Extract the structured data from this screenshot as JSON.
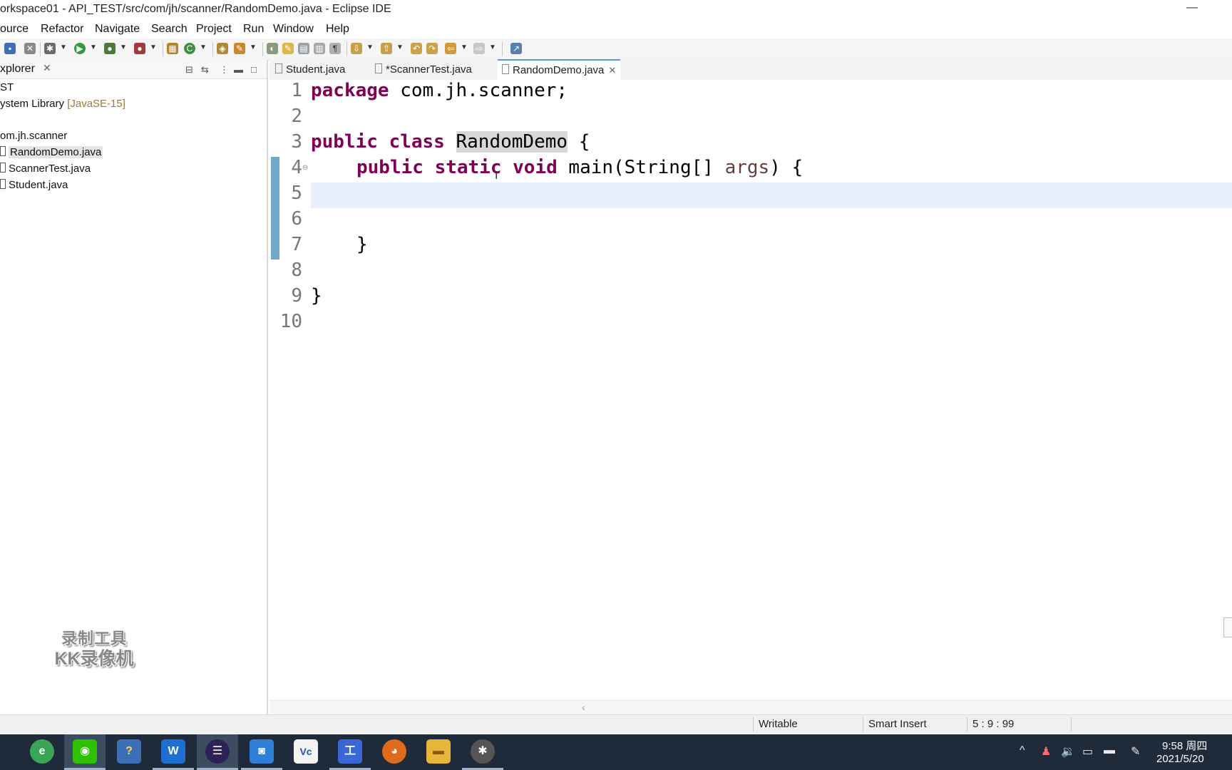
{
  "window": {
    "title": "orkspace01 - API_TEST/src/com/jh/scanner/RandomDemo.java - Eclipse IDE",
    "minimize_glyph": "—"
  },
  "menu": {
    "items": [
      "ource",
      "Refactor",
      "Navigate",
      "Search",
      "Project",
      "Run",
      "Window",
      "Help"
    ]
  },
  "toolbar": {
    "icons": [
      "save-icon",
      "debug-icon",
      "run-icon",
      "coverage-icon",
      "external-tools-icon",
      "new-package-icon",
      "new-class-icon",
      "open-type-icon",
      "search-icon",
      "mark-occurrences-icon",
      "show-whitespace-icon",
      "next-annotation-icon",
      "previous-annotation-icon",
      "back-icon",
      "forward-icon",
      "pin-editor-icon"
    ]
  },
  "explorer": {
    "title": "xplorer",
    "close_glyph": "✕",
    "tree": {
      "project": "ST",
      "library_label": "ystem Library",
      "library_jre": "[JavaSE-15]",
      "package": "om.jh.scanner",
      "files": [
        "RandomDemo.java",
        "ScannerTest.java",
        "Student.java"
      ],
      "selected": "RandomDemo.java"
    }
  },
  "editor": {
    "tabs": [
      {
        "label": "Student.java",
        "active": false
      },
      {
        "label": "*ScannerTest.java",
        "active": false
      },
      {
        "label": "RandomDemo.java",
        "active": true
      }
    ],
    "tab_close_glyph": "✕",
    "line_numbers": [
      "1",
      "2",
      "3",
      "4",
      "5",
      "6",
      "7",
      "8",
      "9",
      "10"
    ],
    "code": {
      "l1_kw": "package",
      "l1_rest": " com.jh.scanner;",
      "l3_kw": "public class",
      "l3_class": "RandomDemo",
      "l3_rest": " {",
      "l4_kw1": "public static void",
      "l4_mid": " main(String[] ",
      "l4_param": "args",
      "l4_end": ") {",
      "l7": "}",
      "l9": "}"
    },
    "current_line": 5
  },
  "status": {
    "writable": "Writable",
    "insert_mode": "Smart Insert",
    "position": "5 : 9 : 99"
  },
  "watermark": {
    "line1": "录制工具",
    "line2": "KK录像机"
  },
  "taskbar": {
    "apps": [
      {
        "name": "browser-app",
        "glyph": "e",
        "color": "#3aa655"
      },
      {
        "name": "wechat-app",
        "glyph": "◉",
        "color": "#2dc100"
      },
      {
        "name": "notes-app",
        "glyph": "?",
        "color": "#3b6fb6"
      },
      {
        "name": "wps-app",
        "glyph": "W",
        "color": "#1f6fd1"
      },
      {
        "name": "eclipse-app",
        "glyph": "☰",
        "color": "#2c2255"
      },
      {
        "name": "contacts-app",
        "glyph": "◙",
        "color": "#2f7fd6"
      },
      {
        "name": "vc-app",
        "glyph": "Vc",
        "color": "#f3f3f3"
      },
      {
        "name": "workbench-app",
        "glyph": "工",
        "color": "#3967d6"
      },
      {
        "name": "game-app",
        "glyph": "◕",
        "color": "#e06a1c"
      },
      {
        "name": "folder-app",
        "glyph": "▬",
        "color": "#e7b53a"
      },
      {
        "name": "tools-app",
        "glyph": "✱",
        "color": "#555555"
      }
    ],
    "clock_time": "9:58 周四",
    "clock_date": "2021/5/20"
  }
}
